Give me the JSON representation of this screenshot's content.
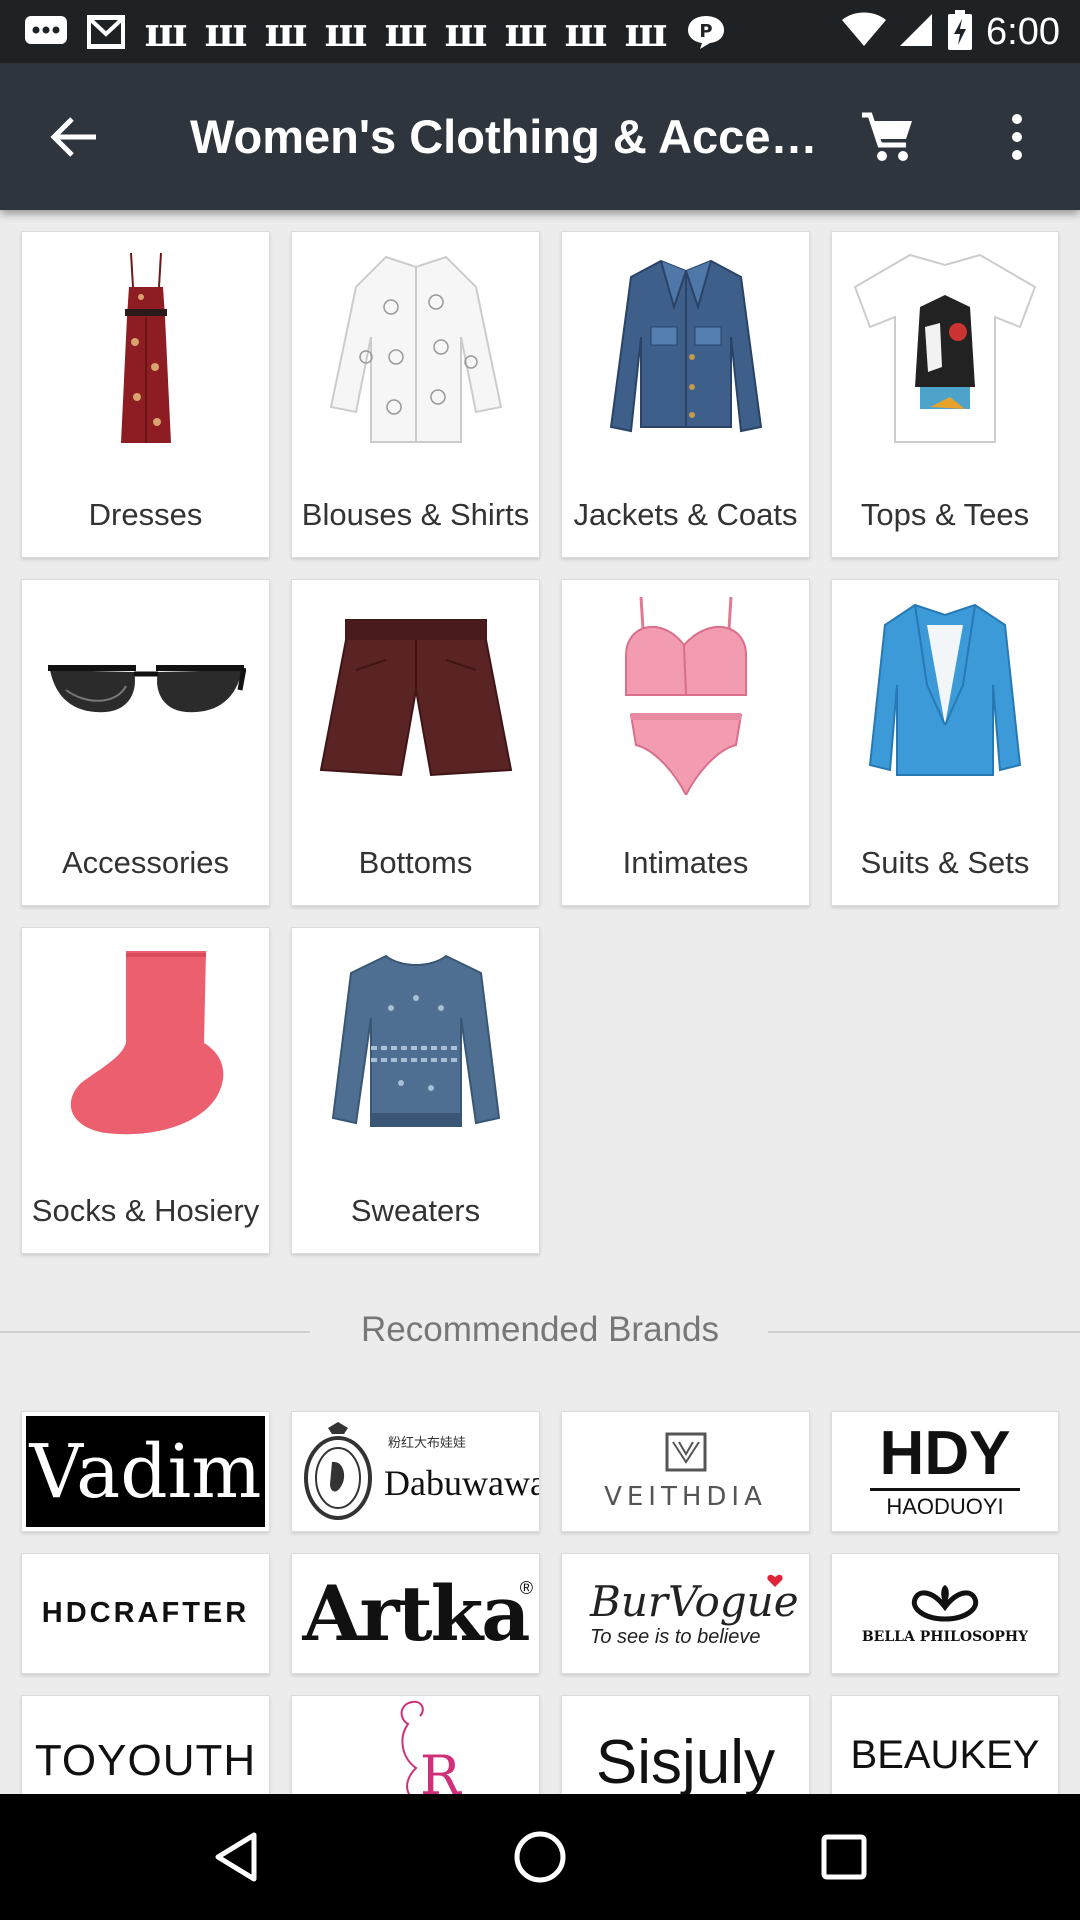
{
  "status_bar": {
    "time": "6:00",
    "notification_icons": [
      "chat-bubble-icon",
      "gmail-icon",
      "w-app-icon",
      "w-app-icon",
      "w-app-icon",
      "w-app-icon",
      "w-app-icon",
      "w-app-icon",
      "w-app-icon",
      "w-app-icon",
      "w-app-icon",
      "message-icon"
    ],
    "system_icons": [
      "wifi-icon",
      "signal-icon",
      "battery-charging-icon"
    ]
  },
  "app_bar": {
    "title": "Women's Clothing & Access...",
    "icons": [
      "back-arrow-icon",
      "cart-icon",
      "more-vert-icon"
    ]
  },
  "categories": [
    {
      "label": "Dresses",
      "icon": "dress-image"
    },
    {
      "label": "Blouses & Shirts",
      "icon": "blouse-image"
    },
    {
      "label": "Jackets & Coats",
      "icon": "jacket-image"
    },
    {
      "label": "Tops & Tees",
      "icon": "tshirt-image"
    },
    {
      "label": "Accessories",
      "icon": "sunglasses-image"
    },
    {
      "label": "Bottoms",
      "icon": "shorts-image"
    },
    {
      "label": "Intimates",
      "icon": "lingerie-image"
    },
    {
      "label": "Suits & Sets",
      "icon": "blazer-image"
    },
    {
      "label": "Socks & Hosiery",
      "icon": "sock-image"
    },
    {
      "label": "Sweaters",
      "icon": "sweater-image"
    }
  ],
  "recommended": {
    "title": "Recommended Brands",
    "brands": [
      {
        "name": "Vadim"
      },
      {
        "name": "Dabuwawa",
        "sub": "粉红大布娃娃"
      },
      {
        "name": "VEITHDIA"
      },
      {
        "name": "HDY",
        "sub": "HAODUOYI"
      },
      {
        "name": "HDCRAFTER"
      },
      {
        "name": "Artka",
        "mark": "®"
      },
      {
        "name": "BurVogue",
        "sub": "To see is to believe"
      },
      {
        "name": "BELLA PHILOSOPHY"
      },
      {
        "name": "TOYOUTH"
      },
      {
        "name": "R"
      },
      {
        "name": "Sisjuly"
      },
      {
        "name": "BEAUKEY"
      }
    ]
  },
  "nav_bar": {
    "icons": [
      "back-triangle-icon",
      "home-circle-icon",
      "recents-square-icon"
    ]
  },
  "colors": {
    "status_bar": "#1e2225",
    "app_bar": "#2f353c",
    "background": "#ececec"
  }
}
